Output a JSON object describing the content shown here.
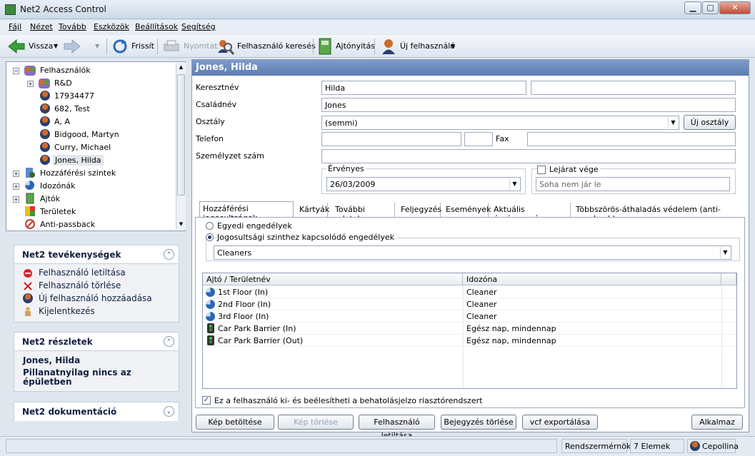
{
  "window": {
    "title": "Net2 Access Control",
    "min": "▁",
    "max": "▢",
    "close": "✕"
  },
  "menu": [
    "Fájl",
    "Nézet",
    "Tovább",
    "Eszközök",
    "Beállítások",
    "Segítség"
  ],
  "toolbar": {
    "back": "Vissza",
    "refresh": "Frissít",
    "print": "Nyomtat",
    "user_search": "Felhasználó keresés",
    "door_open": "Ajtónyitás",
    "new_user": "Új felhasználó"
  },
  "tree": {
    "users_root": "Felhasználók",
    "users": [
      "R&D",
      "17934477",
      "682, Test",
      "A, A",
      "Bidgood, Martyn",
      "Curry, Michael",
      "Jones, Hilda"
    ],
    "access_levels": "Hozzáférési szintek",
    "timezones": "Idozónák",
    "doors": "Ajtók",
    "areas": "Területek",
    "antipassback": "Anti-passback"
  },
  "panels": {
    "activities": {
      "title": "Net2 tevékenységek",
      "items": [
        "Felhasználó letiltása",
        "Felhasználó törlése",
        "Új felhasználó hozzáadása",
        "Kijelentkezés"
      ]
    },
    "details": {
      "title": "Net2 részletek",
      "name": "Jones, Hilda",
      "status": "Pillanatnyilag nincs az épületben"
    },
    "docs": {
      "title": "Net2 dokumentáció"
    }
  },
  "form": {
    "header": "Jones, Hilda",
    "first_name_label": "Keresztnév",
    "first_name": "Hilda",
    "middle_name": "",
    "surname_label": "Családnév",
    "surname": "Jones",
    "department_label": "Osztály",
    "department": "(semmi)",
    "new_department_btn": "Új osztály",
    "phone_label": "Telefon",
    "phone": "",
    "phone_ext": "",
    "fax_label": "Fax",
    "fax": "",
    "staff_no_label": "Személyzet szám",
    "staff_no": "",
    "valid_label": "Érvényes",
    "valid_date": "26/03/2009",
    "expiry_label": "Lejárat vége",
    "expiry_value": "Soha nem jár le"
  },
  "tabs": [
    "Hozzáférési jogosultságok",
    "Kártyák",
    "További adatok",
    "Feljegyzés",
    "Események",
    "Aktuális érvényesség",
    "Többszörös-áthaladás védelem (anti-passback)"
  ],
  "access": {
    "radio_individual": "Egyedi engedélyek",
    "radio_level": "Jogosultsági szinthez kapcsolódó engedélyek",
    "level_value": "Cleaners",
    "col_door": "Ajtó / Területnév",
    "col_timezone": "Idozóna",
    "rows": [
      {
        "door": "1st Floor (In)",
        "tz": "Cleaner",
        "icon": "clock"
      },
      {
        "door": "2nd Floor (In)",
        "tz": "Cleaner",
        "icon": "clock"
      },
      {
        "door": "3rd Floor (In)",
        "tz": "Cleaner",
        "icon": "clock"
      },
      {
        "door": "Car Park Barrier (In)",
        "tz": "Egész nap, mindennap",
        "icon": "traffic-light"
      },
      {
        "door": "Car Park Barrier (Out)",
        "tz": "Egész nap, mindennap",
        "icon": "traffic-light"
      }
    ],
    "alarm_check": "Ez a felhasználó ki- és beélesítheti a behatolásjelzo riasztórendszert"
  },
  "buttons": {
    "load_image": "Kép betöltése",
    "delete_image": "Kép törlése",
    "disable_user": "Felhasználó letiltása",
    "delete_entry": "Bejegyzés törlése",
    "vcf_export": "vcf exportálása",
    "apply": "Alkalmaz"
  },
  "status": {
    "role": "Rendszermérnök",
    "count": "7 Elemek",
    "user": "Cepollina"
  }
}
